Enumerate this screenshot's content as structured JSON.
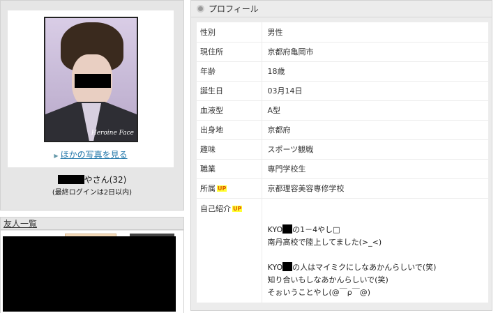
{
  "photo": {
    "watermark": "Heroine Face",
    "more_photos_label": "ほかの写真を見る"
  },
  "user": {
    "name_suffix": "やさん(32)",
    "last_login": "(最終ログインは2日以内)"
  },
  "friends": {
    "header": "友人一覧"
  },
  "profile": {
    "header": "プロフィール",
    "badge_up": "UP",
    "rows": [
      {
        "label": "性別",
        "value": "男性"
      },
      {
        "label": "現住所",
        "value": "京都府亀岡市"
      },
      {
        "label": "年齢",
        "value": "18歳"
      },
      {
        "label": "誕生日",
        "value": "03月14日"
      },
      {
        "label": "血液型",
        "value": "A型"
      },
      {
        "label": "出身地",
        "value": "京都府"
      },
      {
        "label": "趣味",
        "value": "スポーツ観戦"
      },
      {
        "label": "職業",
        "value": "専門学校生"
      },
      {
        "label": "所属",
        "value": "京都理容美容専修学校"
      }
    ],
    "intro": {
      "label": "自己紹介",
      "line1_prefix": "KYO",
      "line1_suffix": "の1－4やし□",
      "line2": "南丹高校で陸上してました(>_<)",
      "line3_prefix": "KYO",
      "line3_suffix": "の人はマイミクにしなあかんらしいで(笑)",
      "line4": "知り合いもしなあかんらしいで(笑)",
      "line5": "そぉいうことやし(@￣ρ￣@)"
    }
  }
}
